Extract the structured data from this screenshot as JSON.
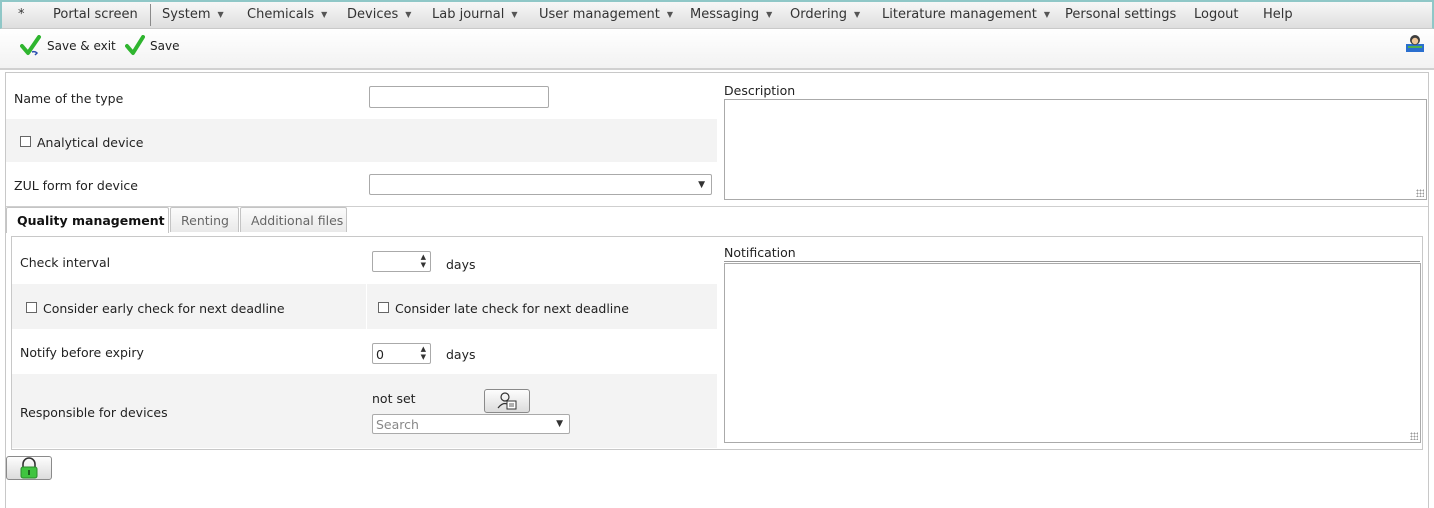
{
  "menu": {
    "star": "*",
    "items": [
      {
        "label": "Portal screen",
        "dropdown": false
      },
      {
        "label": "System",
        "dropdown": true
      },
      {
        "label": "Chemicals",
        "dropdown": true
      },
      {
        "label": "Devices",
        "dropdown": true
      },
      {
        "label": "Lab journal",
        "dropdown": true
      },
      {
        "label": "User management",
        "dropdown": true
      },
      {
        "label": "Messaging",
        "dropdown": true
      },
      {
        "label": "Ordering",
        "dropdown": true
      },
      {
        "label": "Literature management",
        "dropdown": true
      },
      {
        "label": "Personal settings",
        "dropdown": false
      },
      {
        "label": "Logout",
        "dropdown": false
      },
      {
        "label": "Help",
        "dropdown": false
      }
    ]
  },
  "toolbar": {
    "save_exit_label": "Save & exit",
    "save_label": "Save",
    "check_icon": "green-check-icon",
    "user_icon": "user-profile-icon"
  },
  "form": {
    "name_label": "Name of the type",
    "name_value": "",
    "analytical_label": "Analytical device",
    "analytical_checked": false,
    "zul_label": "ZUL form for device",
    "zul_value": "",
    "description_label": "Description",
    "description_value": ""
  },
  "tabs": [
    {
      "label": "Quality management",
      "active": true
    },
    {
      "label": "Renting",
      "active": false
    },
    {
      "label": "Additional files",
      "active": false
    }
  ],
  "quality": {
    "check_interval_label": "Check interval",
    "check_interval_value": "",
    "days_label": "days",
    "early_check_label": "Consider early check for next deadline",
    "late_check_label": "Consider late check for next deadline",
    "notify_label": "Notify before expiry",
    "notify_value": "0",
    "responsible_label": "Responsible for devices",
    "responsible_value": "not set",
    "search_placeholder": "Search",
    "notification_label": "Notification",
    "notification_value": ""
  },
  "colors": {
    "menu_border": "#8fc7c7",
    "check_green": "#2fb52f",
    "shade": "#f3f3f3"
  }
}
